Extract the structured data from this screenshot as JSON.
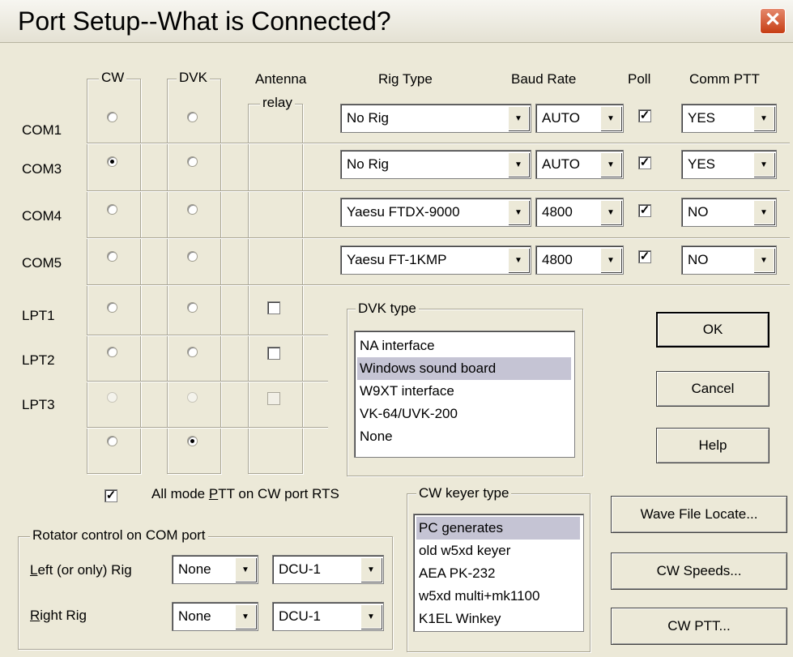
{
  "dialog": {
    "title": "Port Setup--What is Connected?",
    "close_glyph": "✕"
  },
  "columns": {
    "cw": "CW",
    "dvk": "DVK",
    "antenna": "Antenna",
    "relay": "relay",
    "rig_type": "Rig Type",
    "baud_rate": "Baud Rate",
    "poll": "Poll",
    "comm_ptt": "Comm PTT"
  },
  "com_ports": [
    {
      "label": "COM1",
      "cw_selected": false,
      "dvk_selected": false,
      "rig": "No Rig",
      "baud": "AUTO",
      "poll": true,
      "ptt": "YES"
    },
    {
      "label": "COM3",
      "cw_selected": true,
      "dvk_selected": false,
      "rig": "No Rig",
      "baud": "AUTO",
      "poll": true,
      "ptt": "YES"
    },
    {
      "label": "COM4",
      "cw_selected": false,
      "dvk_selected": false,
      "rig": "Yaesu FTDX-9000",
      "baud": "4800",
      "poll": true,
      "ptt": "NO"
    },
    {
      "label": "COM5",
      "cw_selected": false,
      "dvk_selected": false,
      "rig": "Yaesu FT-1KMP",
      "baud": "4800",
      "poll": true,
      "ptt": "NO"
    }
  ],
  "lpt_ports": [
    {
      "label": "LPT1",
      "enabled": true,
      "antenna_relay": false
    },
    {
      "label": "LPT2",
      "enabled": true,
      "antenna_relay": false
    },
    {
      "label": "LPT3",
      "enabled": false,
      "antenna_relay": false
    }
  ],
  "none_row": {
    "cw_selected": false,
    "dvk_selected": true
  },
  "all_mode_ptt": {
    "checked": true,
    "label_before": "All mode ",
    "label_underlined": "P",
    "label_after": "TT on CW port RTS"
  },
  "dvk_type": {
    "legend": "DVK type",
    "items": [
      "NA interface",
      "Windows sound board",
      "W9XT interface",
      "VK-64/UVK-200",
      "None"
    ],
    "selected_index": 1
  },
  "cw_keyer_type": {
    "legend": "CW keyer type",
    "items": [
      "PC generates",
      "old w5xd keyer",
      "AEA PK-232",
      "w5xd multi+mk1100",
      "K1EL Winkey"
    ],
    "selected_index": 0
  },
  "rotator": {
    "legend": "Rotator control on COM port",
    "left_label_underlined": "L",
    "left_label_rest": "eft (or only) Rig",
    "left_port": "None",
    "left_type": "DCU-1",
    "right_label_underlined": "R",
    "right_label_rest": "ight Rig",
    "right_port": "None",
    "right_type": "DCU-1"
  },
  "buttons": {
    "ok": "OK",
    "cancel": "Cancel",
    "help": "Help",
    "wave_file_locate": "Wave File Locate...",
    "cw_speeds": "CW Speeds...",
    "cw_ptt": "CW PTT..."
  }
}
